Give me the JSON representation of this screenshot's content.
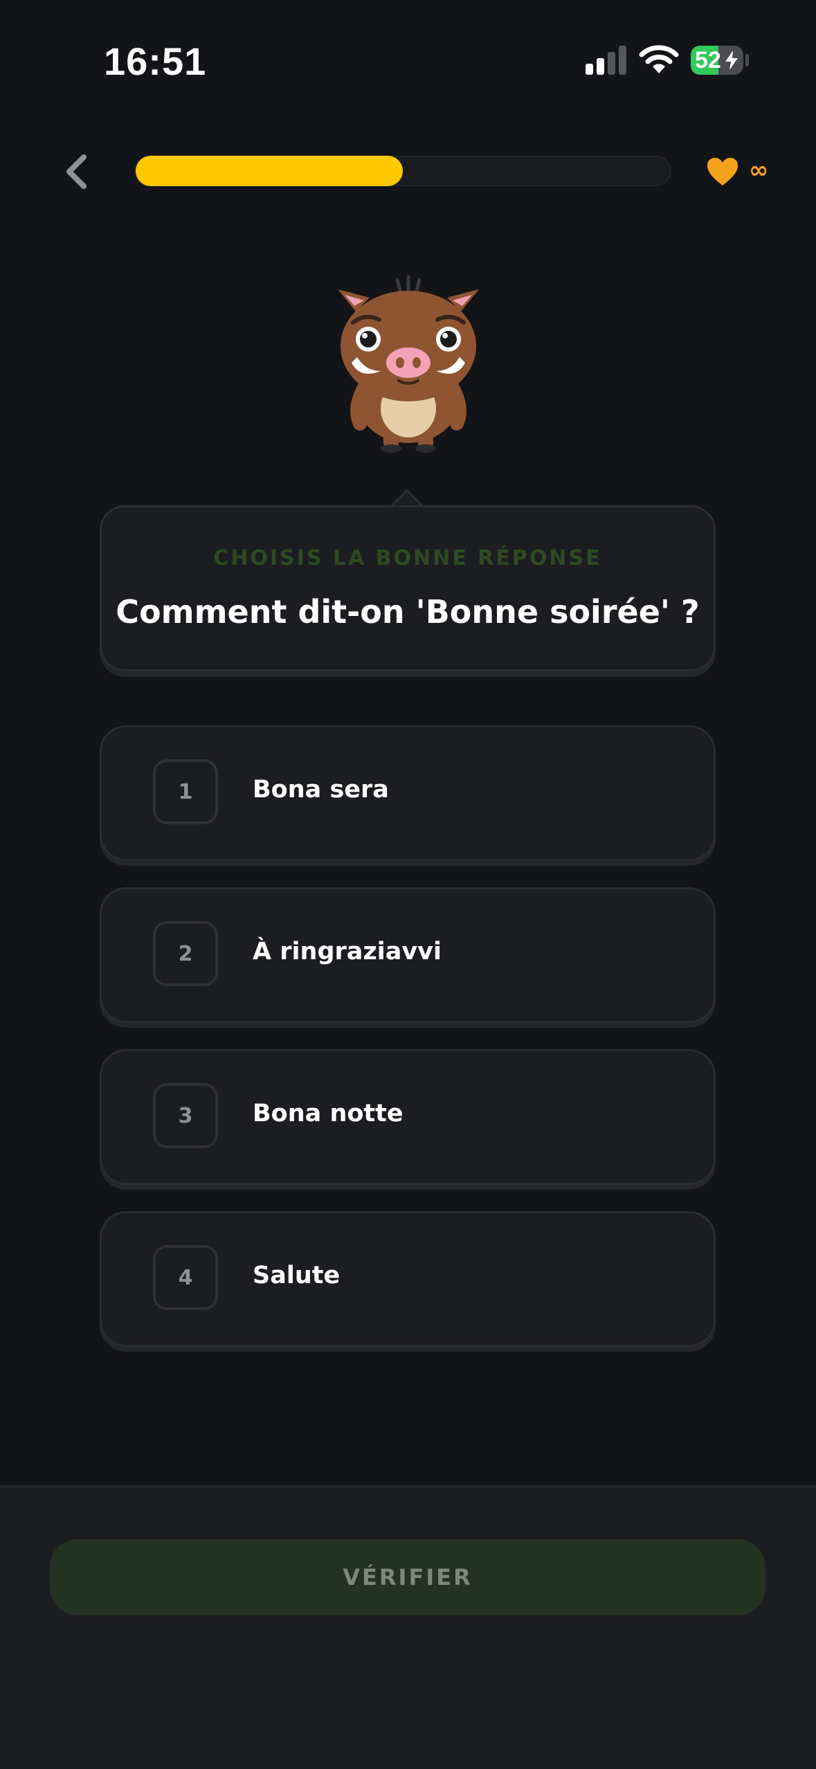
{
  "status_bar": {
    "time": "16:51",
    "battery_level": "52",
    "battery_fraction": 0.52,
    "cellular_bars_active": 2,
    "cellular_bars_total": 4
  },
  "header": {
    "progress_fraction": 0.5,
    "hearts": "∞"
  },
  "question": {
    "instruction": "CHOISIS LA BONNE RÉPONSE",
    "text": "Comment dit-on 'Bonne soirée' ?"
  },
  "options": [
    {
      "number": "1",
      "label": "Bona sera"
    },
    {
      "number": "2",
      "label": "À ringraziavvi"
    },
    {
      "number": "3",
      "label": "Bona notte"
    },
    {
      "number": "4",
      "label": "Salute"
    }
  ],
  "footer": {
    "verify_label": "VÉRIFIER"
  },
  "colors": {
    "background": "#131417",
    "progress": "#ffc800",
    "heart": "#f4a11c",
    "battery": "#34c759",
    "verify_button": "#223322"
  },
  "icons": {
    "back": "chevron-left-icon",
    "heart": "heart-icon",
    "signal": "cellular-signal-icon",
    "wifi": "wifi-icon",
    "battery": "battery-charging-icon",
    "mascot": "boar-mascot"
  }
}
